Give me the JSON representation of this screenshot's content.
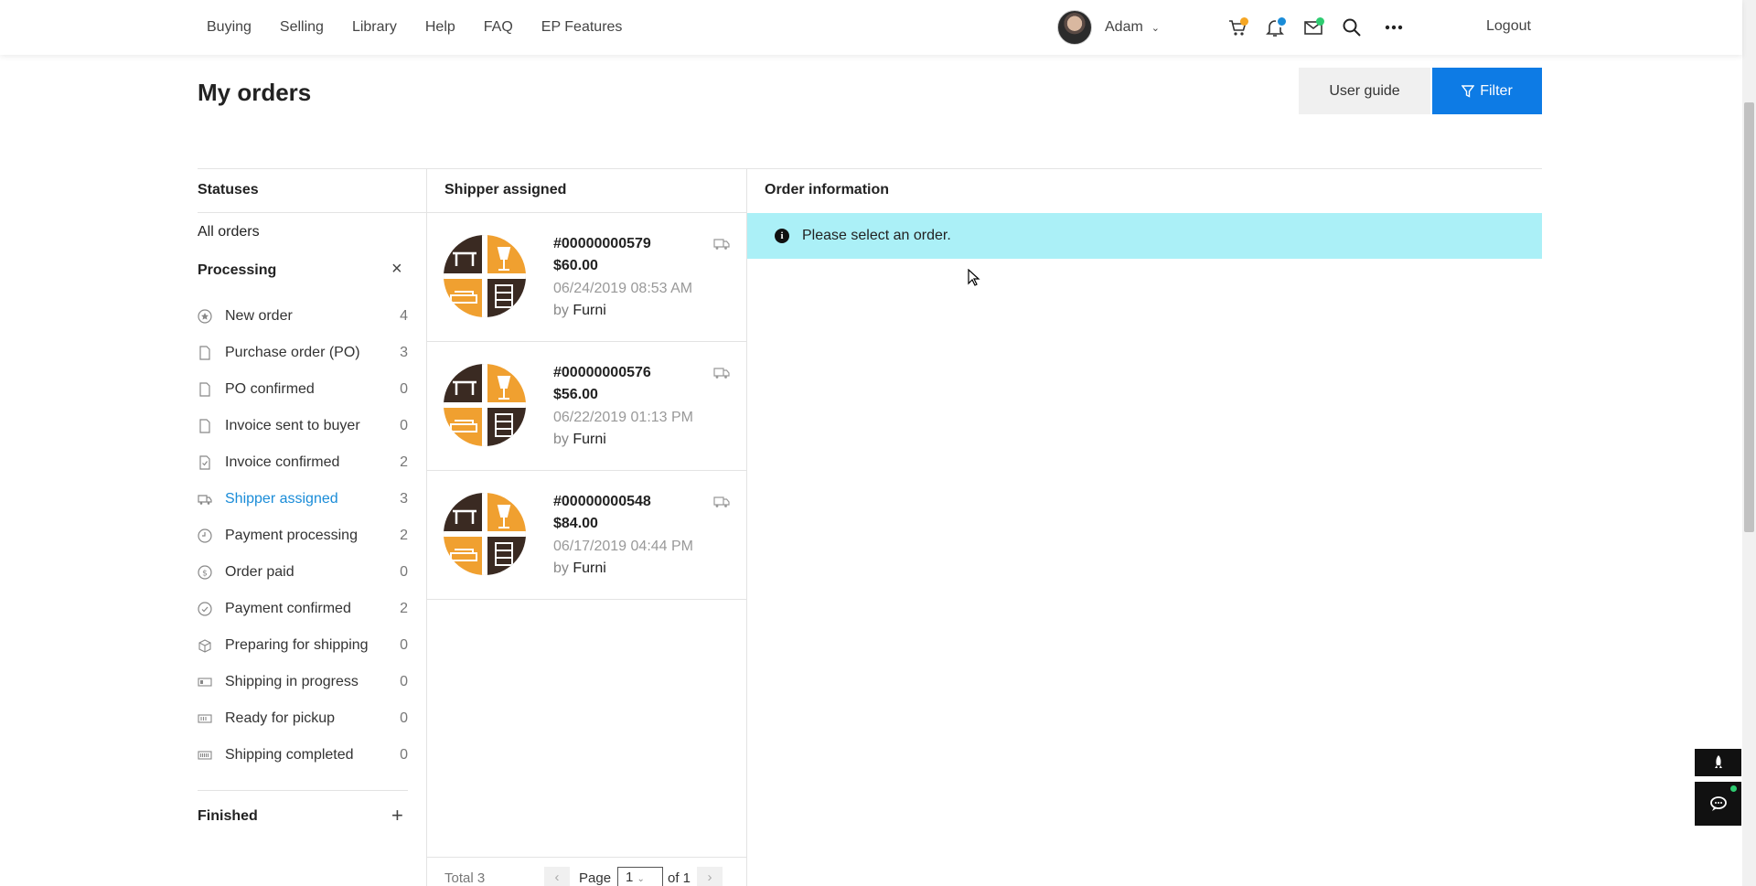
{
  "nav": {
    "items": [
      "Buying",
      "Selling",
      "Library",
      "Help",
      "FAQ",
      "EP Features"
    ],
    "user_name": "Adam",
    "logout_label": "Logout",
    "colors": {
      "cart_badge": "#f5a623",
      "bell_badge": "#1a8cd8",
      "mail_badge": "#2ecc71"
    }
  },
  "page": {
    "title": "My orders",
    "user_guide_label": "User guide",
    "filter_label": "Filter",
    "accent_color": "#0d7be5"
  },
  "statuses": {
    "heading": "Statuses",
    "all_label": "All orders",
    "processing_label": "Processing",
    "finished_label": "Finished",
    "items": [
      {
        "icon": "star-circle-icon",
        "label": "New order",
        "count": "4"
      },
      {
        "icon": "document-icon",
        "label": "Purchase order (PO)",
        "count": "3"
      },
      {
        "icon": "document-icon",
        "label": "PO confirmed",
        "count": "0"
      },
      {
        "icon": "document-icon",
        "label": "Invoice sent to buyer",
        "count": "0"
      },
      {
        "icon": "document-check-icon",
        "label": "Invoice confirmed",
        "count": "2"
      },
      {
        "icon": "truck-icon",
        "label": "Shipper assigned",
        "count": "3",
        "active": true
      },
      {
        "icon": "clock-icon",
        "label": "Payment processing",
        "count": "2"
      },
      {
        "icon": "dollar-circle-icon",
        "label": "Order paid",
        "count": "0"
      },
      {
        "icon": "check-circle-icon",
        "label": "Payment confirmed",
        "count": "2"
      },
      {
        "icon": "box-icon",
        "label": "Preparing for shipping",
        "count": "0"
      },
      {
        "icon": "progress-bar-icon",
        "label": "Shipping in progress",
        "count": "0"
      },
      {
        "icon": "barcode-icon",
        "label": "Ready for pickup",
        "count": "0"
      },
      {
        "icon": "barcode-full-icon",
        "label": "Shipping completed",
        "count": "0"
      }
    ]
  },
  "orders": {
    "heading": "Shipper assigned",
    "by_prefix": "by",
    "list": [
      {
        "number": "#00000000579",
        "price": "$60.00",
        "date": "06/24/2019 08:53 AM",
        "seller": "Furni"
      },
      {
        "number": "#00000000576",
        "price": "$56.00",
        "date": "06/22/2019 01:13 PM",
        "seller": "Furni"
      },
      {
        "number": "#00000000548",
        "price": "$84.00",
        "date": "06/17/2019 04:44 PM",
        "seller": "Furni"
      }
    ],
    "pagination": {
      "total_label": "Total 3",
      "page_label": "Page",
      "page_value": "1",
      "of_label": "of 1"
    }
  },
  "order_info": {
    "heading": "Order information",
    "message": "Please select an order.",
    "info_color": "#abf0f7"
  }
}
